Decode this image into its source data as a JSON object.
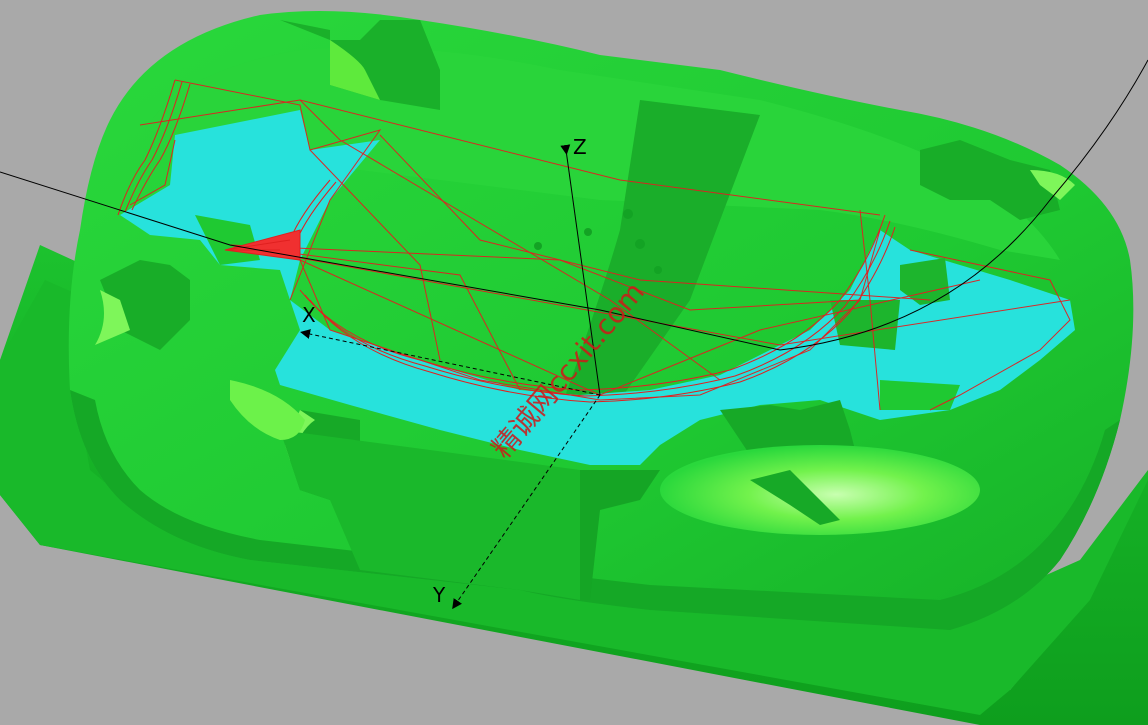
{
  "viewport": {
    "background_color": "#a9a9a9"
  },
  "colors": {
    "base_dark": "#0fae1f",
    "base_mid": "#18c72b",
    "body_light": "#22d436",
    "body_mid": "#1ec22f",
    "body_dark": "#14a824",
    "pocket": "#22e0de",
    "highlight": "#6cf24a",
    "toolpath": "#e02020",
    "axis": "#000000"
  },
  "axes": {
    "x_label": "X",
    "y_label": "Y",
    "z_label": "Z"
  },
  "watermark": {
    "text": "精诚网ccxit.com"
  },
  "icons": {
    "axis_arrow": "arrowhead"
  }
}
